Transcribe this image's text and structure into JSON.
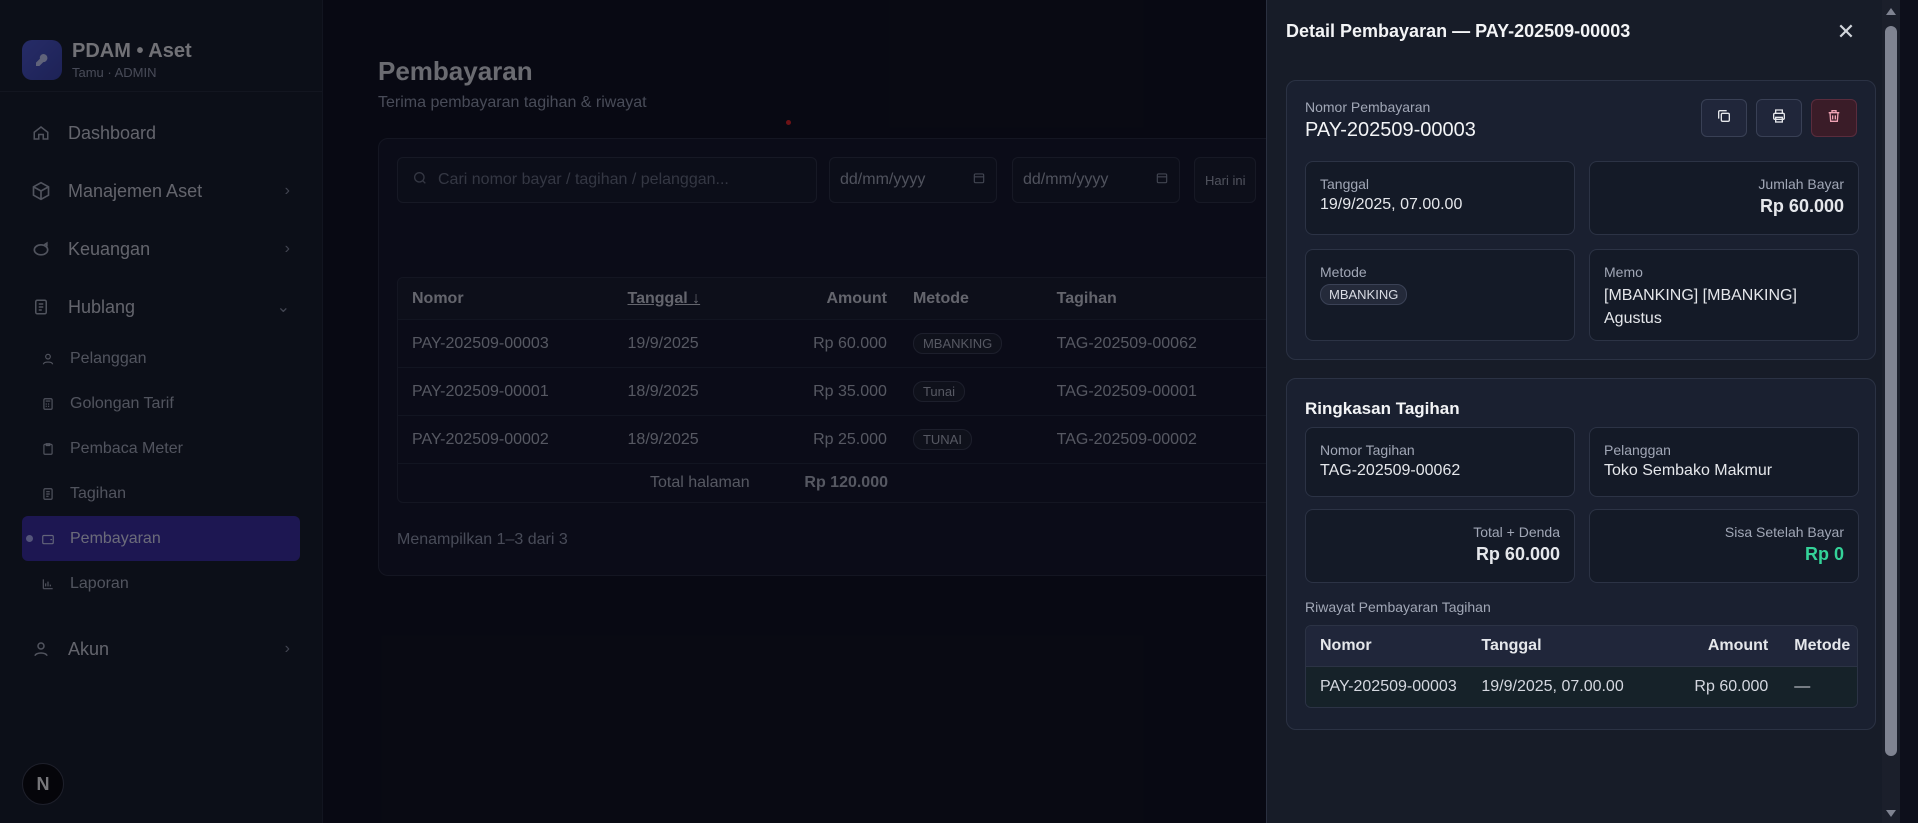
{
  "brand": {
    "title": "PDAM • Aset",
    "subtitle": "Tamu · ADMIN"
  },
  "nav": {
    "dashboard": "Dashboard",
    "manajemen_aset": "Manajemen Aset",
    "keuangan": "Keuangan",
    "hublang": "Hublang",
    "sub": [
      "Pelanggan",
      "Golongan Tarif",
      "Pembaca Meter",
      "Tagihan",
      "Pembayaran",
      "Laporan"
    ],
    "akun": "Akun",
    "badge": "N"
  },
  "page": {
    "title": "Pembayaran",
    "subtitle": "Terima pembayaran tagihan & riwayat"
  },
  "filters": {
    "search_placeholder": "Cari nomor bayar / tagihan / pelanggan...",
    "date_from": "dd/mm/yyyy",
    "date_to": "dd/mm/yyyy",
    "today": "Hari ini"
  },
  "table": {
    "headers": {
      "nomor": "Nomor",
      "tanggal": "Tanggal ↓",
      "amount": "Amount",
      "metode": "Metode",
      "tagihan": "Tagihan"
    },
    "rows": [
      {
        "nomor": "PAY-202509-00003",
        "tanggal": "19/9/2025",
        "amount": "Rp 60.000",
        "metode": "MBANKING",
        "tagihan": "TAG-202509-00062"
      },
      {
        "nomor": "PAY-202509-00001",
        "tanggal": "18/9/2025",
        "amount": "Rp 35.000",
        "metode": "Tunai",
        "tagihan": "TAG-202509-00001"
      },
      {
        "nomor": "PAY-202509-00002",
        "tanggal": "18/9/2025",
        "amount": "Rp 25.000",
        "metode": "TUNAI",
        "tagihan": "TAG-202509-00002"
      }
    ],
    "total_label": "Total halaman",
    "total_value": "Rp 120.000",
    "showing": "Menampilkan 1–3 dari 3"
  },
  "drawer": {
    "title": "Detail Pembayaran — PAY-202509-00003",
    "nomor_label": "Nomor Pembayaran",
    "nomor_value": "PAY-202509-00003",
    "tanggal_label": "Tanggal",
    "tanggal_value": "19/9/2025, 07.00.00",
    "jumlah_label": "Jumlah Bayar",
    "jumlah_value": "Rp 60.000",
    "metode_label": "Metode",
    "metode_value": "MBANKING",
    "memo_label": "Memo",
    "memo_value": "[MBANKING] [MBANKING] Agustus",
    "ringkasan_title": "Ringkasan Tagihan",
    "nomor_tagihan_label": "Nomor Tagihan",
    "nomor_tagihan_value": "TAG-202509-00062",
    "pelanggan_label": "Pelanggan",
    "pelanggan_value": "Toko Sembako Makmur",
    "total_denda_label": "Total + Denda",
    "total_denda_value": "Rp 60.000",
    "sisa_label": "Sisa Setelah Bayar",
    "sisa_value": "Rp 0",
    "riwayat_label": "Riwayat Pembayaran Tagihan",
    "riwayat_headers": {
      "nomor": "Nomor",
      "tanggal": "Tanggal",
      "amount": "Amount",
      "metode": "Metode"
    },
    "riwayat_row": {
      "nomor": "PAY-202509-00003",
      "tanggal": "19/9/2025, 07.00.00",
      "amount": "Rp 60.000",
      "metode": "—"
    }
  }
}
